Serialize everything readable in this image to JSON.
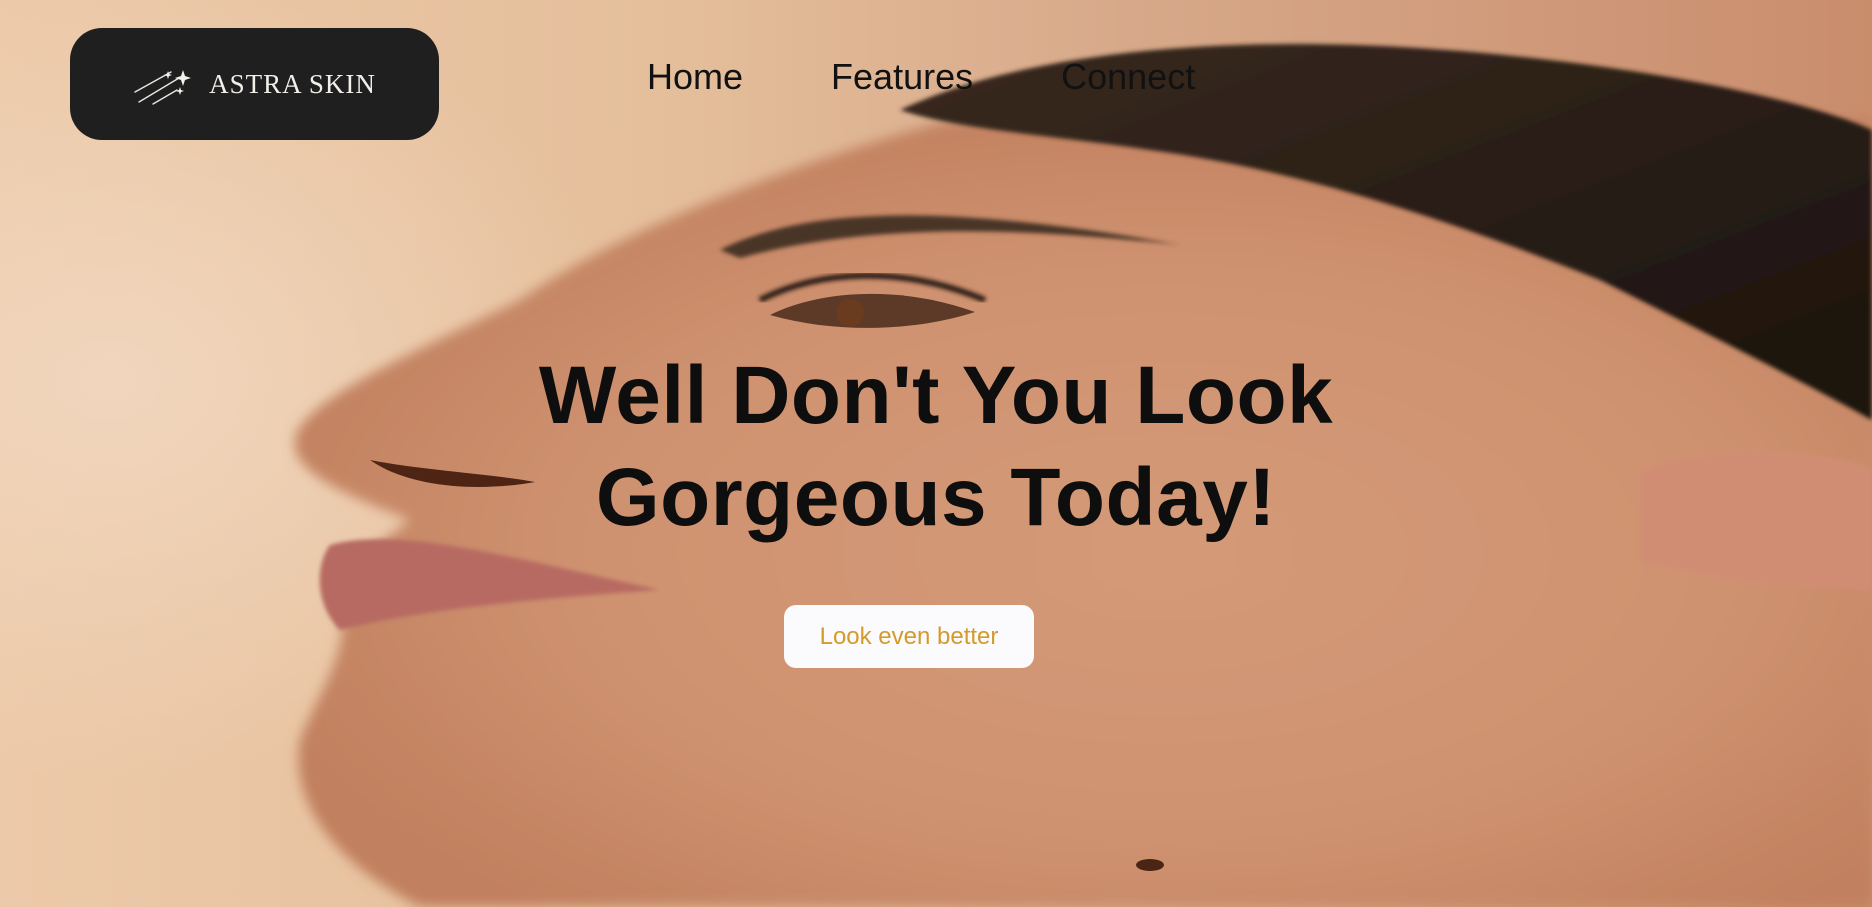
{
  "brand": {
    "name": "ASTRA SKIN"
  },
  "nav": {
    "items": [
      {
        "label": "Home"
      },
      {
        "label": "Features"
      },
      {
        "label": "Connect"
      }
    ]
  },
  "hero": {
    "headline_line1": "Well Don't You Look",
    "headline_line2": "Gorgeous Today!",
    "cta_label": "Look even better",
    "background_image": "woman-profile-looking-up-photo"
  },
  "colors": {
    "logo_bg": "#1f1f1f",
    "cta_text": "#d49a2a",
    "cta_bg": "#fbfbfd",
    "headline": "#0e0e0e"
  }
}
